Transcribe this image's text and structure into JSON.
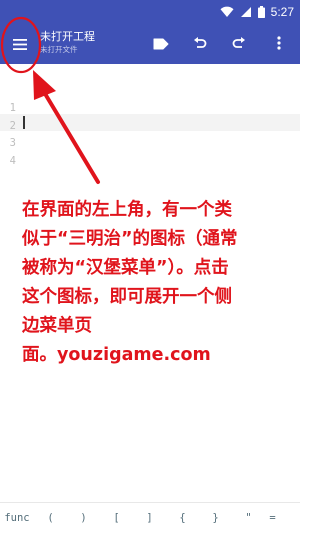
{
  "status_bar": {
    "time": "5:27",
    "color": "#3f51b5",
    "icons": [
      "wifi-icon",
      "signal-icon",
      "battery-icon"
    ]
  },
  "toolbar": {
    "title": "未打开工程",
    "subtitle": "未打开文件",
    "menu_icon": "hamburger-menu-icon",
    "actions": [
      "run-icon",
      "undo-icon",
      "redo-icon",
      "more-vert-icon"
    ]
  },
  "editor": {
    "line_numbers": [
      "1",
      "2",
      "3",
      "4"
    ],
    "current_line": 2
  },
  "annotation": {
    "color": "#e0141c",
    "lines": [
      "在界面的左上角，有一个类",
      "似于“三明治”的图标（通常",
      "被称为“汉堡菜单”）。点击",
      "这个图标，即可展开一个侧",
      "边菜单页",
      "面。youzigame.com"
    ]
  },
  "symbol_bar": {
    "symbols": [
      "func",
      "(",
      ")",
      "[",
      "]",
      "{",
      "}",
      "\"",
      "="
    ]
  }
}
